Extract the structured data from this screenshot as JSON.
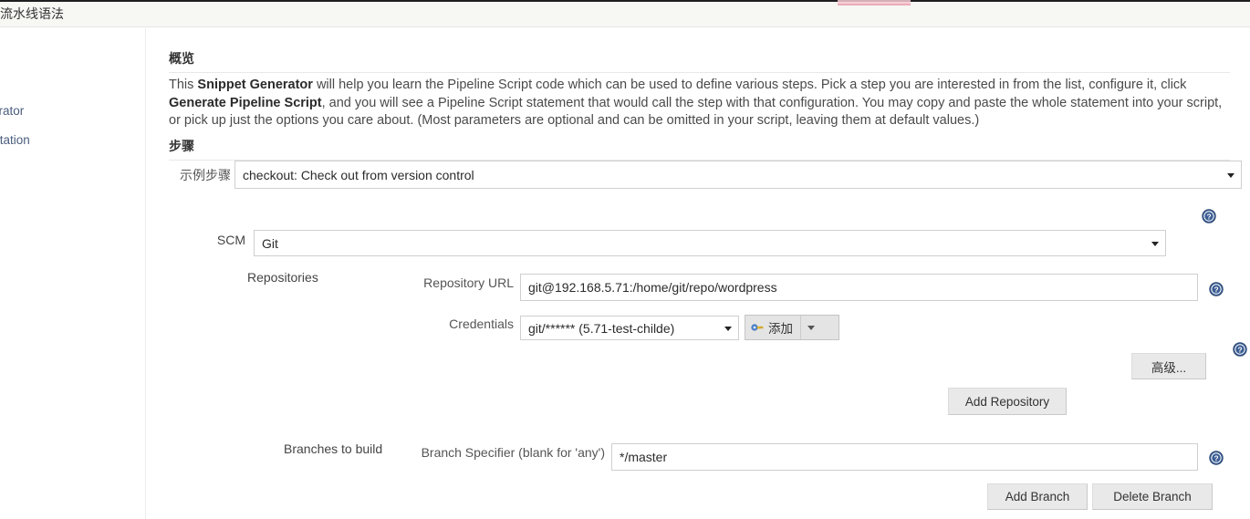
{
  "topbar": {
    "title": "流水线语法"
  },
  "sidebar": {
    "items": [
      {
        "label": "enerator"
      },
      {
        "label": "umentation"
      }
    ]
  },
  "overview": {
    "heading": "概览",
    "paragraph": {
      "t1": "This ",
      "b1": "Snippet Generator",
      "t2": " will help you learn the Pipeline Script code which can be used to define various steps. Pick a step you are interested in from the list, configure it, click ",
      "b2": "Generate Pipeline Script",
      "t3": ", and you will see a Pipeline Script statement that would call the step with that configuration. You may copy and paste the whole statement into your script, or pick up just the options you care about. (Most parameters are optional and can be omitted in your script, leaving them at default values.)"
    }
  },
  "steps": {
    "heading": "步骤",
    "sample_step": {
      "label": "示例步骤",
      "value": "checkout: Check out from version control"
    }
  },
  "scm": {
    "label": "SCM",
    "value": "Git",
    "repositories": {
      "label": "Repositories",
      "repository_url": {
        "label": "Repository URL",
        "value": "git@192.168.5.71:/home/git/repo/wordpress"
      },
      "credentials": {
        "label": "Credentials",
        "value": "git/****** (5.71-test-childe)",
        "add_button": "添加",
        "add_icon": "key-icon"
      },
      "advanced_button": "高级...",
      "add_repository_button": "Add Repository"
    },
    "branches": {
      "label": "Branches to build",
      "branch_specifier": {
        "label": "Branch Specifier (blank for 'any')",
        "value": "*/master"
      },
      "add_branch_button": "Add Branch",
      "delete_branch_button": "Delete Branch"
    }
  },
  "icons": {
    "help": "help-icon",
    "caret_down": "chevron-down-icon"
  },
  "colors": {
    "help_blue": "#3b5d93",
    "topbar_bg": "#f7f7f4",
    "button_bg": "#e9e9e9",
    "link": "#4b5e7e"
  }
}
